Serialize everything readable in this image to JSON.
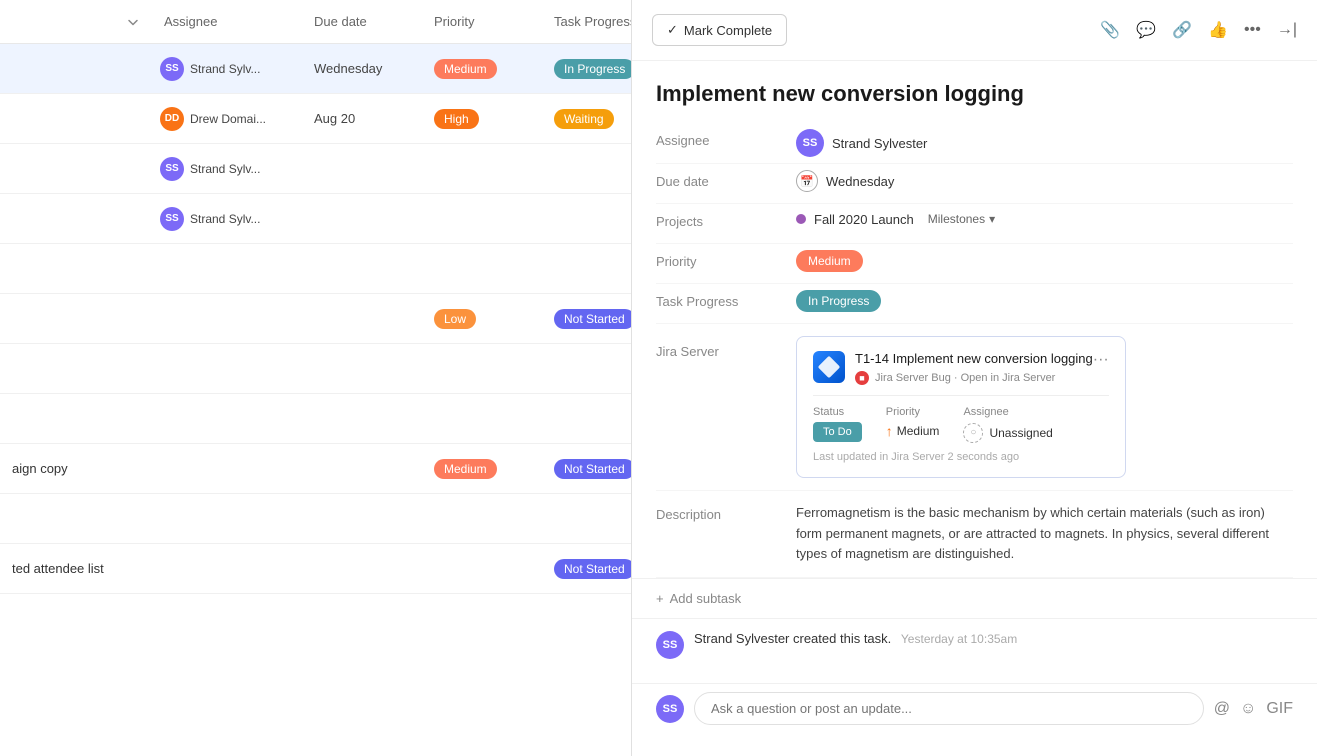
{
  "table": {
    "headers": {
      "assignee": "Assignee",
      "due_date": "Due date",
      "priority": "Priority",
      "task_progress": "Task Progress"
    },
    "rows": [
      {
        "id": 1,
        "name": "",
        "highlighted": true,
        "assignee_name": "Strand Sylv...",
        "assignee_initials": "SS",
        "due_date": "Wednesday",
        "priority": "Medium",
        "priority_class": "badge-medium",
        "task_progress": "In Progress",
        "task_progress_class": "badge-in-progress"
      },
      {
        "id": 2,
        "name": "",
        "highlighted": false,
        "assignee_name": "Drew Domai...",
        "assignee_initials": "DD",
        "due_date": "Aug 20",
        "priority": "High",
        "priority_class": "badge-high",
        "task_progress": "Waiting",
        "task_progress_class": "badge-waiting"
      },
      {
        "id": 3,
        "name": "",
        "highlighted": false,
        "assignee_name": "Strand Sylv...",
        "assignee_initials": "SS",
        "due_date": "",
        "priority": "",
        "priority_class": "",
        "task_progress": "",
        "task_progress_class": ""
      },
      {
        "id": 4,
        "name": "",
        "highlighted": false,
        "assignee_name": "Strand Sylv...",
        "assignee_initials": "SS",
        "due_date": "",
        "priority": "",
        "priority_class": "",
        "task_progress": "",
        "task_progress_class": ""
      },
      {
        "id": 5,
        "name": "",
        "highlighted": false,
        "assignee_name": "",
        "assignee_initials": "",
        "due_date": "",
        "priority": "",
        "priority_class": "",
        "task_progress": "",
        "task_progress_class": ""
      },
      {
        "id": 6,
        "name": "",
        "highlighted": false,
        "assignee_name": "",
        "assignee_initials": "",
        "due_date": "",
        "priority": "Low",
        "priority_class": "badge-low",
        "task_progress": "Not Started",
        "task_progress_class": "badge-not-started"
      },
      {
        "id": 7,
        "name": "",
        "highlighted": false,
        "assignee_name": "",
        "assignee_initials": "",
        "due_date": "",
        "priority": "",
        "priority_class": "",
        "task_progress": "",
        "task_progress_class": ""
      },
      {
        "id": 8,
        "name": "",
        "highlighted": false,
        "assignee_name": "",
        "assignee_initials": "",
        "due_date": "",
        "priority": "",
        "priority_class": "",
        "task_progress": "",
        "task_progress_class": ""
      },
      {
        "id": 9,
        "name": "aign copy",
        "highlighted": false,
        "assignee_name": "",
        "assignee_initials": "",
        "due_date": "",
        "priority": "Medium",
        "priority_class": "badge-medium",
        "task_progress": "Not Started",
        "task_progress_class": "badge-not-started"
      },
      {
        "id": 10,
        "name": "",
        "highlighted": false,
        "assignee_name": "",
        "assignee_initials": "",
        "due_date": "",
        "priority": "",
        "priority_class": "",
        "task_progress": "",
        "task_progress_class": ""
      },
      {
        "id": 11,
        "name": "ted attendee list",
        "highlighted": false,
        "assignee_name": "",
        "assignee_initials": "",
        "due_date": "",
        "priority": "",
        "priority_class": "",
        "task_progress": "Not Started",
        "task_progress_class": "badge-not-started"
      }
    ]
  },
  "task_detail": {
    "title": "Implement new conversion logging",
    "mark_complete_label": "Mark Complete",
    "fields": {
      "assignee_label": "Assignee",
      "assignee_name": "Strand Sylvester",
      "assignee_initials": "SS",
      "due_date_label": "Due date",
      "due_date": "Wednesday",
      "projects_label": "Projects",
      "project_name": "Fall 2020 Launch",
      "milestones_label": "Milestones",
      "priority_label": "Priority",
      "priority": "Medium",
      "task_progress_label": "Task Progress",
      "task_progress": "In Progress",
      "jira_server_label": "Jira Server"
    },
    "jira": {
      "ticket_id": "T1-14",
      "ticket_title": "Implement new conversion logging",
      "source": "Jira Server Bug · Open in Jira Server",
      "status_label": "Status",
      "status_value": "To Do",
      "priority_label": "Priority",
      "priority_value": "Medium",
      "assignee_label": "Assignee",
      "assignee_value": "Unassigned",
      "last_updated": "Last updated in Jira Server 2 seconds ago",
      "more_options": "···"
    },
    "description_label": "Description",
    "description": "Ferromagnetism is the basic mechanism by which certain materials (such as iron) form permanent magnets, or are attracted to magnets. In physics, several different types of magnetism are distinguished.",
    "add_subtask_label": "+ Add subtask",
    "activity": {
      "author": "Strand Sylvester",
      "action": "created this task.",
      "time": "Yesterday at 10:35am"
    },
    "comment_placeholder": "Ask a question or post an update..."
  }
}
